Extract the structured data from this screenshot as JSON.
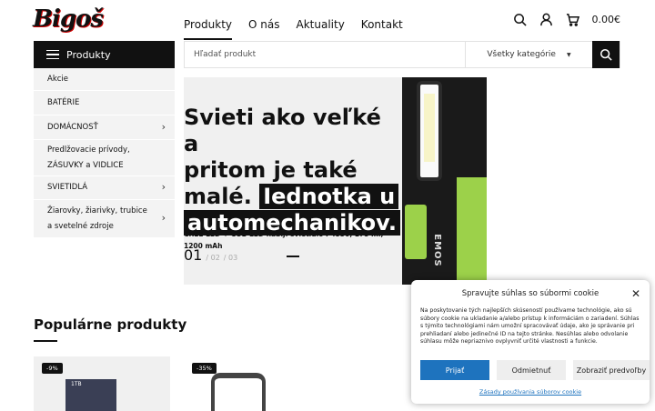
{
  "logo": {
    "text": "Bigoš"
  },
  "nav": {
    "items": [
      "Produkty",
      "O nás",
      "Aktuality",
      "Kontakt"
    ]
  },
  "header": {
    "cart_total": "0.00€"
  },
  "categories": {
    "title": "Produkty",
    "items": [
      {
        "label": "Akcie",
        "has_sub": false
      },
      {
        "label": "BATÉRIE",
        "has_sub": false
      },
      {
        "label": "DOMÁCNOSŤ",
        "has_sub": true
      },
      {
        "label": "Predlžovacie prívody, ZÁSUVKY a VIDLICE",
        "has_sub": false
      },
      {
        "label": "SVIETIDLÁ",
        "has_sub": true
      },
      {
        "label": "Žiarovky, žiarivky, trubice a svetelné zdroje",
        "has_sub": true
      }
    ]
  },
  "search": {
    "placeholder": "Hľadať produkt",
    "category": "Všetky kategórie"
  },
  "hero": {
    "line1": "Svieti ako veľké a",
    "line2": "pritom je také",
    "line3a": "malé.",
    "line3b": "Iednotka u",
    "line4": "automechanikov.",
    "subtitle": "CREE LED + COB LED nabij. svietidlo P4530, 175 lm, 1200 mAh",
    "slide_current": "01",
    "slide_2": "/ 02",
    "slide_3": "/ 03",
    "product_brand": "EMOS"
  },
  "popular": {
    "title": "Populárne produkty",
    "badges": [
      "-9%",
      "-35%"
    ]
  },
  "cookie": {
    "title": "Spravujte súhlas so súbormi cookie",
    "text": "Na poskytovanie tých najlepších skúseností používame technológie, ako sú súbory cookie na ukladanie a/alebo prístup k informáciám o zariadení. Súhlas s týmito technológiami nám umožní spracovávať údaje, ako je správanie pri prehliadaní alebo jedinečné ID na tejto stránke. Nesúhlas alebo odvolanie súhlasu môže nepriaznivo ovplyvniť určité vlastnosti a funkcie.",
    "accept": "Prijať",
    "deny": "Odmietnuť",
    "prefs": "Zobraziť predvoľby",
    "policy": "Zásady používania súborov cookie"
  }
}
